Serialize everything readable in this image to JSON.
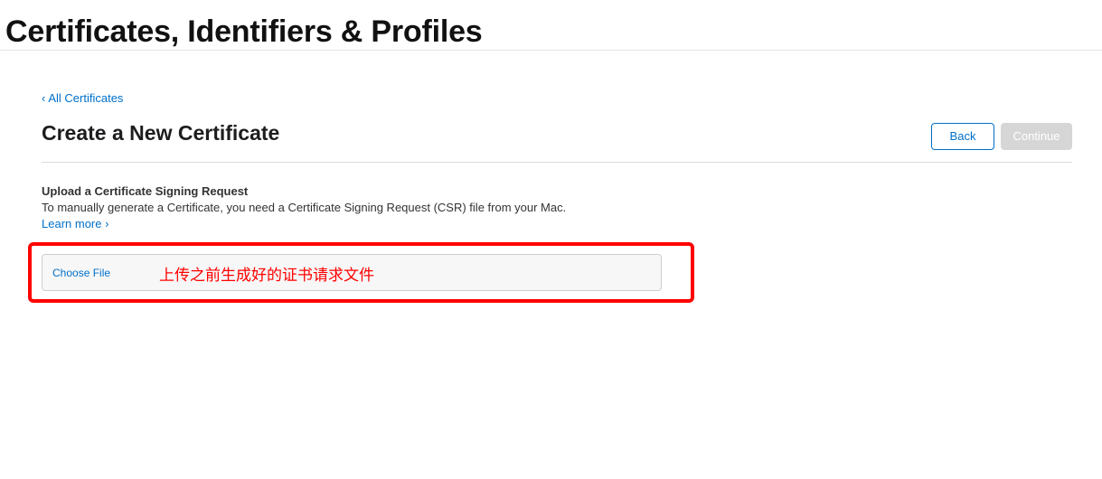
{
  "header": {
    "title": "Certificates, Identifiers & Profiles"
  },
  "nav": {
    "back_chevron": "‹",
    "back_link_label": "All Certificates"
  },
  "page": {
    "heading": "Create a New Certificate"
  },
  "actions": {
    "back_label": "Back",
    "continue_label": "Continue",
    "continue_enabled": false
  },
  "upload": {
    "title": "Upload a Certificate Signing Request",
    "description": "To manually generate a Certificate, you need a Certificate Signing Request (CSR) file from your Mac.",
    "learn_more_label": "Learn more",
    "learn_more_chevron": "›",
    "choose_file_label": "Choose File"
  },
  "annotation": {
    "text": "上传之前生成好的证书请求文件",
    "color": "#ff0000"
  },
  "colors": {
    "link": "#0070c9",
    "disabled_button": "#d6d6d6",
    "highlight": "#ff0000"
  }
}
